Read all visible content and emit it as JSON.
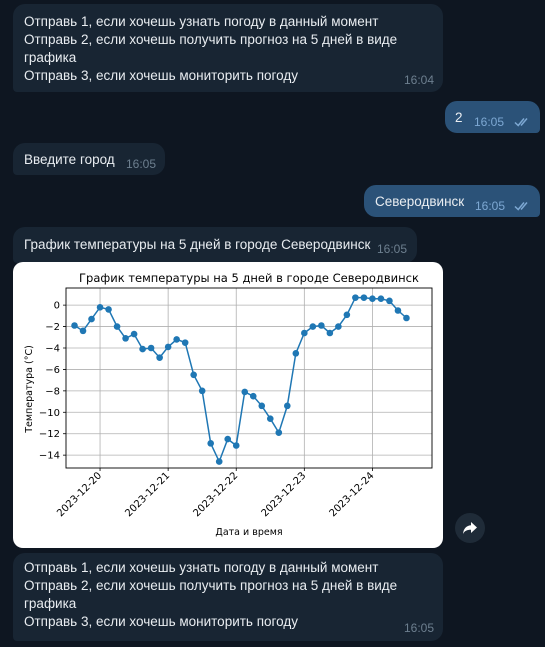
{
  "messages": {
    "m1": {
      "text": "Отправь 1, если хочешь узнать погоду в данный момент\nОтправь 2, если хочешь получить прогноз на 5 дней в виде графика\nОтправь 3, если хочешь мониторить погоду",
      "time": "16:04"
    },
    "m2": {
      "text": "2",
      "time": "16:05"
    },
    "m3": {
      "text": "Введите город",
      "time": "16:05"
    },
    "m4": {
      "text": "Северодвинск",
      "time": "16:05"
    },
    "m5": {
      "text": "График температуры на 5 дней в городе Северодвинск",
      "time": "16:05"
    },
    "m6": {
      "text": "Отправь 1, если хочешь узнать погоду в данный момент\nОтправь 2, если хочешь получить прогноз на 5 дней в виде графика\nОтправь 3, если хочешь мониторить погоду",
      "time": "16:05"
    }
  },
  "icons": {
    "read": "double-check-icon",
    "share": "share-arrow-icon"
  },
  "colors": {
    "background": "#0e1621",
    "incoming": "#182533",
    "outgoing": "#2b5278",
    "line": "#1f77b4"
  },
  "chart_data": {
    "type": "line",
    "title": "График температуры на 5 дней в городе Северодвинск",
    "xlabel": "Дата и время",
    "ylabel": "Температура (°C)",
    "x_ticks": [
      "2023-12-20",
      "2023-12-21",
      "2023-12-22",
      "2023-12-23",
      "2023-12-24"
    ],
    "y_ticks": [
      0,
      -2,
      -4,
      -6,
      -8,
      -10,
      -12,
      -14
    ],
    "ylim": [
      -15.2,
      1.6
    ],
    "xlim": [
      "2023-12-19 12:00",
      "2023-12-24 21:00"
    ],
    "grid": true,
    "x": [
      "2023-12-19 15:00",
      "2023-12-19 18:00",
      "2023-12-19 21:00",
      "2023-12-20 00:00",
      "2023-12-20 03:00",
      "2023-12-20 06:00",
      "2023-12-20 09:00",
      "2023-12-20 12:00",
      "2023-12-20 15:00",
      "2023-12-20 18:00",
      "2023-12-20 21:00",
      "2023-12-21 00:00",
      "2023-12-21 03:00",
      "2023-12-21 06:00",
      "2023-12-21 09:00",
      "2023-12-21 12:00",
      "2023-12-21 15:00",
      "2023-12-21 18:00",
      "2023-12-21 21:00",
      "2023-12-22 00:00",
      "2023-12-22 03:00",
      "2023-12-22 06:00",
      "2023-12-22 09:00",
      "2023-12-22 12:00",
      "2023-12-22 15:00",
      "2023-12-22 18:00",
      "2023-12-22 21:00",
      "2023-12-23 00:00",
      "2023-12-23 03:00",
      "2023-12-23 06:00",
      "2023-12-23 09:00",
      "2023-12-23 12:00",
      "2023-12-23 15:00",
      "2023-12-23 18:00",
      "2023-12-23 21:00",
      "2023-12-24 00:00",
      "2023-12-24 03:00",
      "2023-12-24 06:00",
      "2023-12-24 09:00",
      "2023-12-24 12:00"
    ],
    "values": [
      -1.9,
      -2.4,
      -1.3,
      -0.2,
      -0.4,
      -2.0,
      -3.1,
      -2.7,
      -4.1,
      -4.0,
      -4.9,
      -3.9,
      -3.2,
      -3.5,
      -6.5,
      -8.0,
      -12.9,
      -14.6,
      -12.5,
      -13.1,
      -8.1,
      -8.5,
      -9.4,
      -10.6,
      -11.9,
      -9.4,
      -4.5,
      -2.6,
      -2.0,
      -1.9,
      -2.6,
      -2.0,
      -0.9,
      0.7,
      0.7,
      0.6,
      0.6,
      0.4,
      -0.5,
      -1.2
    ]
  }
}
